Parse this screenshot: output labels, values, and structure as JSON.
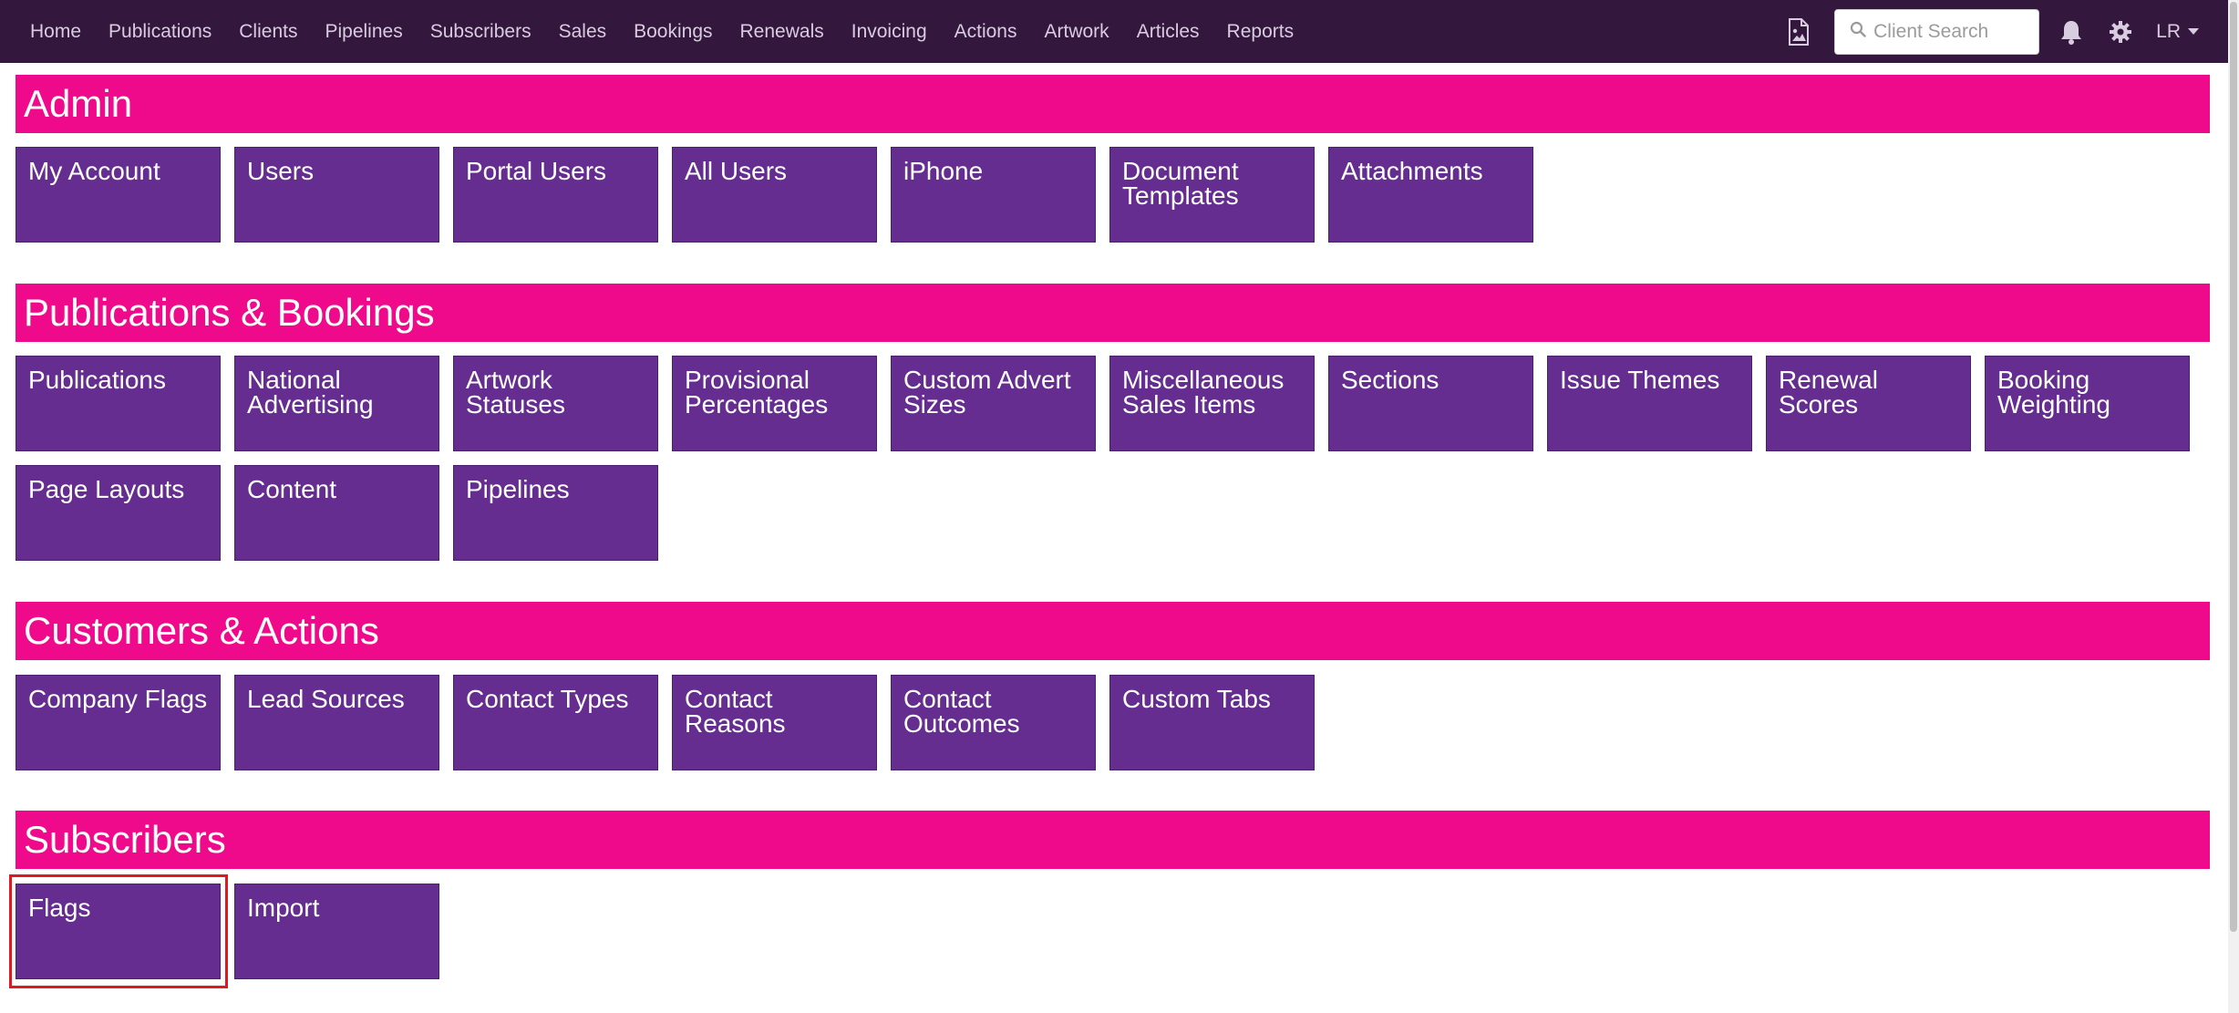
{
  "nav": {
    "links": [
      "Home",
      "Publications",
      "Clients",
      "Pipelines",
      "Subscribers",
      "Sales",
      "Bookings",
      "Renewals",
      "Invoicing",
      "Actions",
      "Artwork",
      "Articles",
      "Reports"
    ],
    "search_placeholder": "Client Search",
    "user_initials": "LR"
  },
  "sections": {
    "admin": {
      "title": "Admin",
      "tiles": [
        "My Account",
        "Users",
        "Portal Users",
        "All Users",
        "iPhone",
        "Document Templates",
        "Attachments"
      ]
    },
    "publications": {
      "title": "Publications & Bookings",
      "tiles": [
        "Publications",
        "National Advertising",
        "Artwork Statuses",
        "Provisional Percentages",
        "Custom Advert Sizes",
        "Miscellaneous Sales Items",
        "Sections",
        "Issue Themes",
        "Renewal Scores",
        "Booking Weighting",
        "Page Layouts",
        "Content",
        "Pipelines"
      ]
    },
    "customers": {
      "title": "Customers & Actions",
      "tiles": [
        "Company Flags",
        "Lead Sources",
        "Contact Types",
        "Contact Reasons",
        "Contact Outcomes",
        "Custom Tabs"
      ]
    },
    "subscribers": {
      "title": "Subscribers",
      "tiles": [
        "Flags",
        "Import"
      ]
    }
  },
  "colors": {
    "navbar": "#34173d",
    "section_header": "#ee0a8a",
    "tile": "#652d90",
    "highlight": "#e0191f"
  }
}
